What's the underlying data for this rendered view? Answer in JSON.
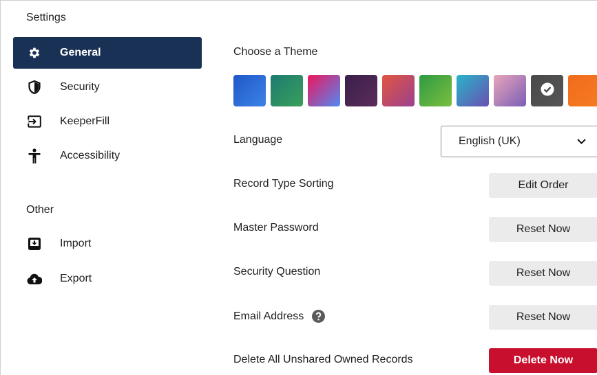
{
  "sidebar": {
    "settings_title": "Settings",
    "other_title": "Other",
    "items": [
      {
        "label": "General",
        "icon": "gear-icon",
        "active": true
      },
      {
        "label": "Security",
        "icon": "shield-icon"
      },
      {
        "label": "KeeperFill",
        "icon": "keeperfill-icon"
      },
      {
        "label": "Accessibility",
        "icon": "accessibility-icon"
      }
    ],
    "other_items": [
      {
        "label": "Import",
        "icon": "import-icon"
      },
      {
        "label": "Export",
        "icon": "cloud-upload-icon"
      }
    ]
  },
  "main": {
    "theme_label": "Choose a Theme",
    "themes": [
      {
        "name": "blue",
        "colors": [
          "#1f58c8",
          "#3c83e6"
        ]
      },
      {
        "name": "teal-green",
        "colors": [
          "#1c7a72",
          "#3aa05a"
        ]
      },
      {
        "name": "pink-blue",
        "colors": [
          "#f0155c",
          "#4f8af2"
        ]
      },
      {
        "name": "dark-purple",
        "colors": [
          "#3a1e4a",
          "#5b2d5b"
        ]
      },
      {
        "name": "coral-purple",
        "colors": [
          "#e0573f",
          "#9c4090"
        ]
      },
      {
        "name": "green",
        "colors": [
          "#2e9a43",
          "#7bbf3f"
        ]
      },
      {
        "name": "cyan-purple",
        "colors": [
          "#27b5c8",
          "#6a4fb3"
        ]
      },
      {
        "name": "pastel",
        "colors": [
          "#e8a6b8",
          "#7b5db8"
        ]
      },
      {
        "name": "dark-gray",
        "colors": [
          "#4a4a4a",
          "#555555"
        ],
        "selected": true
      },
      {
        "name": "orange",
        "colors": [
          "#f26b1d",
          "#f47c20"
        ]
      }
    ],
    "language_label": "Language",
    "language_value": "English (UK)",
    "record_sorting_label": "Record Type Sorting",
    "record_sorting_button": "Edit Order",
    "master_password_label": "Master Password",
    "master_password_button": "Reset Now",
    "security_question_label": "Security Question",
    "security_question_button": "Reset Now",
    "email_label": "Email Address",
    "email_button": "Reset Now",
    "delete_label": "Delete All Unshared Owned Records",
    "delete_button": "Delete Now"
  },
  "colors": {
    "active_nav_bg": "#1a3156",
    "danger": "#c8102e",
    "button_bg": "#ebebeb"
  }
}
